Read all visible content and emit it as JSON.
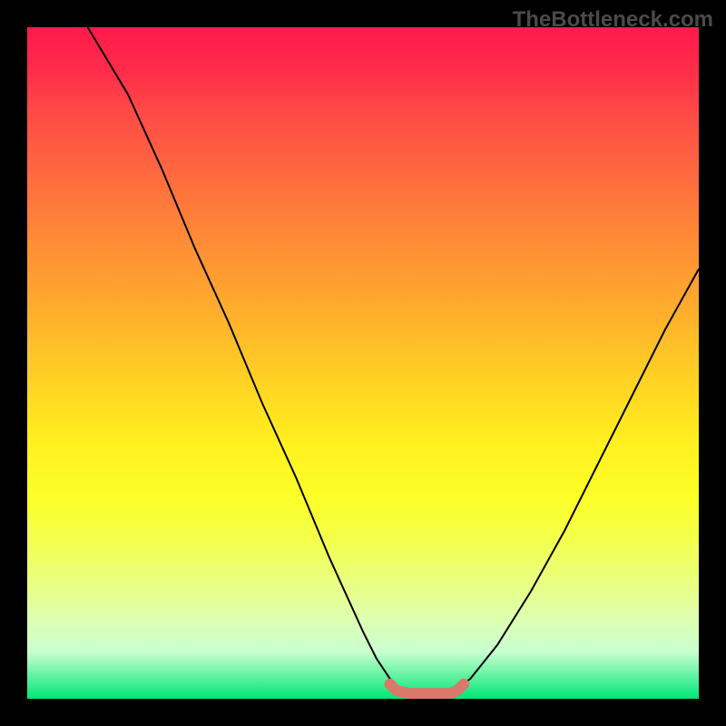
{
  "watermark": "TheBottleneck.com",
  "chart_data": {
    "type": "line",
    "title": "",
    "xlabel": "",
    "ylabel": "",
    "xlim": [
      0,
      100
    ],
    "ylim": [
      0,
      100
    ],
    "grid": false,
    "series": [
      {
        "name": "left-curve",
        "x": [
          9,
          15,
          20,
          25,
          30,
          35,
          40,
          45,
          50,
          52,
          54,
          56
        ],
        "y": [
          100,
          90,
          79,
          67,
          56,
          44,
          33,
          21,
          10,
          6,
          3,
          0.8
        ]
      },
      {
        "name": "right-curve",
        "x": [
          63,
          66,
          70,
          75,
          80,
          85,
          90,
          95,
          100
        ],
        "y": [
          0.8,
          3,
          8,
          16,
          25,
          35,
          45,
          55,
          64
        ]
      },
      {
        "name": "marker-band",
        "x": [
          54,
          55,
          57,
          59,
          61,
          63,
          64,
          65
        ],
        "y": [
          2.2,
          1.2,
          0.8,
          0.8,
          0.8,
          0.8,
          1.2,
          2.2
        ]
      }
    ],
    "gradient": {
      "top_color": "#ff1a4d",
      "mid_color": "#fff01f",
      "bottom_color": "#00e676"
    }
  }
}
